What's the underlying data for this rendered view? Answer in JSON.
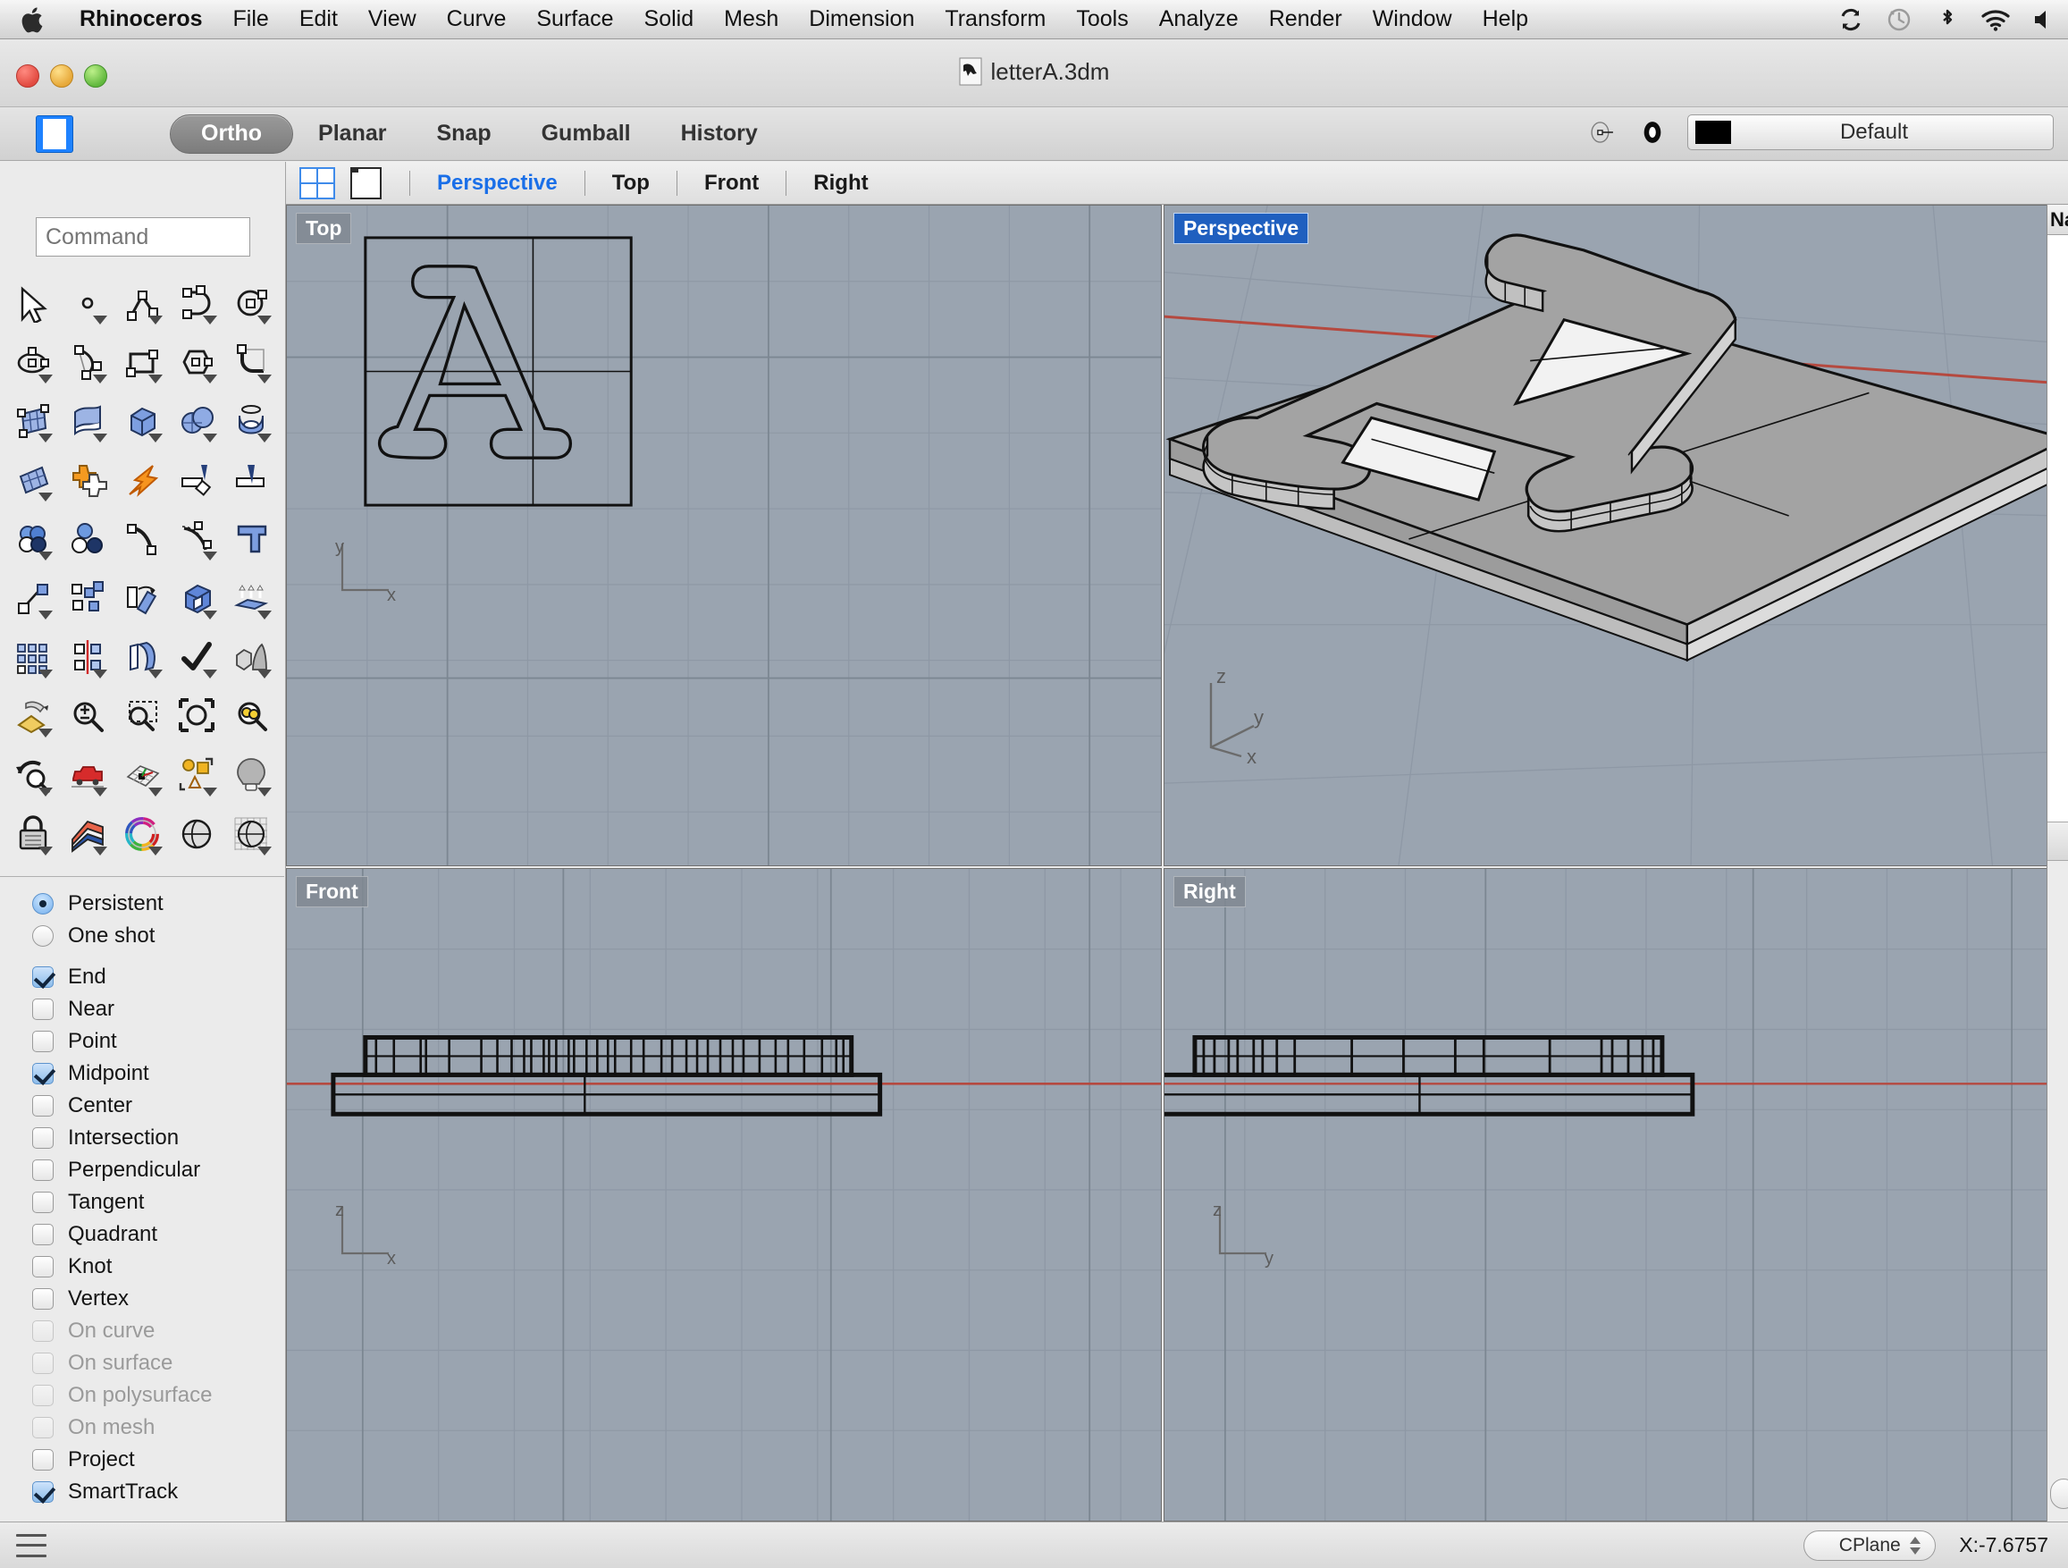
{
  "menubar": {
    "apple_icon": "apple-logo-icon",
    "items": [
      {
        "label": "Rhinoceros",
        "bold": true
      },
      {
        "label": "File"
      },
      {
        "label": "Edit"
      },
      {
        "label": "View"
      },
      {
        "label": "Curve"
      },
      {
        "label": "Surface"
      },
      {
        "label": "Solid"
      },
      {
        "label": "Mesh"
      },
      {
        "label": "Dimension"
      },
      {
        "label": "Transform"
      },
      {
        "label": "Tools"
      },
      {
        "label": "Analyze"
      },
      {
        "label": "Render"
      },
      {
        "label": "Window"
      },
      {
        "label": "Help"
      }
    ],
    "status_icons": [
      "sync-icon",
      "time-machine-icon",
      "bluetooth-icon",
      "wifi-icon",
      "volume-icon"
    ]
  },
  "window": {
    "title": "letterA.3dm",
    "doc_icon": "rhino-document-icon"
  },
  "toolbar": {
    "panel_toggle_icon": "sidebar-panel-icon",
    "modes": [
      {
        "label": "Ortho",
        "active": true
      },
      {
        "label": "Planar",
        "active": false
      },
      {
        "label": "Snap",
        "active": false
      },
      {
        "label": "Gumball",
        "active": false
      },
      {
        "label": "History",
        "active": false
      }
    ],
    "layer_icons": [
      "osnap-target-icon",
      "layer-ring-icon"
    ],
    "layer_color": "#000000",
    "layer_name": "Default"
  },
  "viewtabs": {
    "four_view_icon": "four-viewport-icon",
    "single_view_icon": "single-viewport-icon",
    "tabs": [
      {
        "label": "Perspective",
        "active": true
      },
      {
        "label": "Top",
        "active": false
      },
      {
        "label": "Front",
        "active": false
      },
      {
        "label": "Right",
        "active": false
      }
    ]
  },
  "sidebar": {
    "command": {
      "placeholder": "Command",
      "value": ""
    },
    "tools": [
      {
        "name": "select-arrow",
        "caret": false
      },
      {
        "name": "point",
        "caret": true
      },
      {
        "name": "polyline",
        "caret": true
      },
      {
        "name": "arc",
        "caret": true
      },
      {
        "name": "circle",
        "caret": true
      },
      {
        "name": "ellipse",
        "caret": true
      },
      {
        "name": "curve-arc-start",
        "caret": true
      },
      {
        "name": "rectangle",
        "caret": true
      },
      {
        "name": "polygon",
        "caret": true
      },
      {
        "name": "fillet-curves",
        "caret": true
      },
      {
        "name": "surface-from-points",
        "caret": true
      },
      {
        "name": "extrude-surface",
        "caret": true
      },
      {
        "name": "box",
        "caret": true
      },
      {
        "name": "sphere-boolean",
        "caret": true
      },
      {
        "name": "revolve-surface",
        "caret": true
      },
      {
        "name": "surface-from-curve-network",
        "caret": true
      },
      {
        "name": "boolean-union",
        "caret": false
      },
      {
        "name": "explode",
        "caret": false
      },
      {
        "name": "trim",
        "caret": false
      },
      {
        "name": "split",
        "caret": false
      },
      {
        "name": "boolean-difference",
        "caret": true
      },
      {
        "name": "boolean-split-circles",
        "caret": false
      },
      {
        "name": "curve-point-edit",
        "caret": false
      },
      {
        "name": "rebuild-curve",
        "caret": true
      },
      {
        "name": "text-tool",
        "caret": false
      },
      {
        "name": "connect-points",
        "caret": true
      },
      {
        "name": "group-objects",
        "caret": false
      },
      {
        "name": "orient-object",
        "caret": false
      },
      {
        "name": "cap-solid",
        "caret": true
      },
      {
        "name": "extrude-planar-curve",
        "caret": true
      },
      {
        "name": "array",
        "caret": true
      },
      {
        "name": "mirror",
        "caret": true
      },
      {
        "name": "flow-along-surface",
        "caret": true
      },
      {
        "name": "check-object",
        "caret": true
      },
      {
        "name": "mesh-from-solid",
        "caret": true
      },
      {
        "name": "paint-pyramid",
        "caret": true
      },
      {
        "name": "zoom-in-out",
        "caret": false
      },
      {
        "name": "zoom-window",
        "caret": false
      },
      {
        "name": "zoom-extents",
        "caret": false
      },
      {
        "name": "zoom-selected",
        "caret": false
      },
      {
        "name": "undo-view",
        "caret": true
      },
      {
        "name": "pan-camera",
        "caret": true
      },
      {
        "name": "set-cplane",
        "caret": true
      },
      {
        "name": "select-objects",
        "caret": true
      },
      {
        "name": "light",
        "caret": true
      },
      {
        "name": "lock-object",
        "caret": true
      },
      {
        "name": "render-material",
        "caret": true
      },
      {
        "name": "color-wheel",
        "caret": true
      },
      {
        "name": "shaded-view",
        "caret": false
      },
      {
        "name": "wireframe-view",
        "caret": true
      },
      {
        "name": "render-preview",
        "caret": true
      },
      {
        "name": "spotlight",
        "caret": true
      },
      {
        "name": "dimension-tool",
        "caret": true
      }
    ],
    "osnap": {
      "mode_options": [
        {
          "label": "Persistent",
          "type": "radio",
          "checked": true,
          "disabled": false
        },
        {
          "label": "One shot",
          "type": "radio",
          "checked": false,
          "disabled": false
        }
      ],
      "snaps": [
        {
          "label": "End",
          "checked": true,
          "disabled": false
        },
        {
          "label": "Near",
          "checked": false,
          "disabled": false
        },
        {
          "label": "Point",
          "checked": false,
          "disabled": false
        },
        {
          "label": "Midpoint",
          "checked": true,
          "disabled": false
        },
        {
          "label": "Center",
          "checked": false,
          "disabled": false
        },
        {
          "label": "Intersection",
          "checked": false,
          "disabled": false
        },
        {
          "label": "Perpendicular",
          "checked": false,
          "disabled": false
        },
        {
          "label": "Tangent",
          "checked": false,
          "disabled": false
        },
        {
          "label": "Quadrant",
          "checked": false,
          "disabled": false
        },
        {
          "label": "Knot",
          "checked": false,
          "disabled": false
        },
        {
          "label": "Vertex",
          "checked": false,
          "disabled": false
        },
        {
          "label": "On curve",
          "checked": false,
          "disabled": true
        },
        {
          "label": "On surface",
          "checked": false,
          "disabled": true
        },
        {
          "label": "On polysurface",
          "checked": false,
          "disabled": true
        },
        {
          "label": "On mesh",
          "checked": false,
          "disabled": true
        },
        {
          "label": "Project",
          "checked": false,
          "disabled": false
        },
        {
          "label": "SmartTrack",
          "checked": true,
          "disabled": false
        }
      ]
    }
  },
  "viewports": {
    "top": {
      "label": "Top",
      "active": false,
      "axes": [
        "y",
        "x"
      ]
    },
    "persp": {
      "label": "Perspective",
      "active": true,
      "axes": [
        "z",
        "y",
        "x"
      ]
    },
    "front": {
      "label": "Front",
      "active": false,
      "axes": [
        "z",
        "x"
      ]
    },
    "right": {
      "label": "Right",
      "active": false,
      "axes": [
        "z",
        "y"
      ]
    },
    "background_color": "#9aa4b0",
    "grid_color": "#8b95a2",
    "axis_red": "#b5493f",
    "shade_light": "#a9a9a9",
    "shade_dark": "#8f8f8f",
    "shade_white": "#f2f2f2"
  },
  "right_panel": {
    "header": "Na"
  },
  "statusbar": {
    "menu_icon": "hamburger-icon",
    "cplane_label": "CPlane",
    "coordinate_x": "X:-7.6757"
  }
}
